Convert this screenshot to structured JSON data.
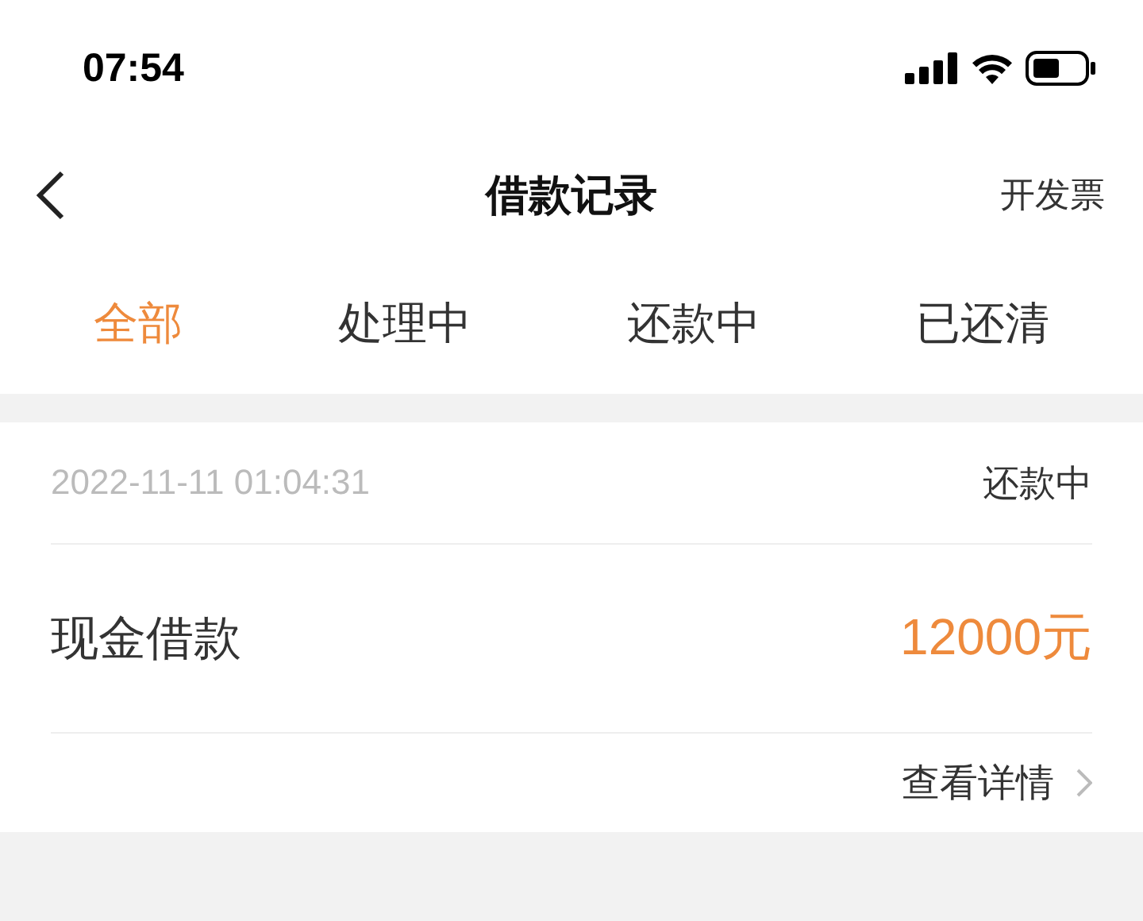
{
  "status_bar": {
    "time": "07:54"
  },
  "nav": {
    "title": "借款记录",
    "action": "开发票"
  },
  "tabs": [
    {
      "label": "全部",
      "selected": true
    },
    {
      "label": "处理中",
      "selected": false
    },
    {
      "label": "还款中",
      "selected": false
    },
    {
      "label": "已还清",
      "selected": false
    }
  ],
  "records": [
    {
      "datetime": "2022-11-11 01:04:31",
      "status": "还款中",
      "name": "现金借款",
      "amount": "12000元",
      "detail_link": "查看详情"
    }
  ]
}
